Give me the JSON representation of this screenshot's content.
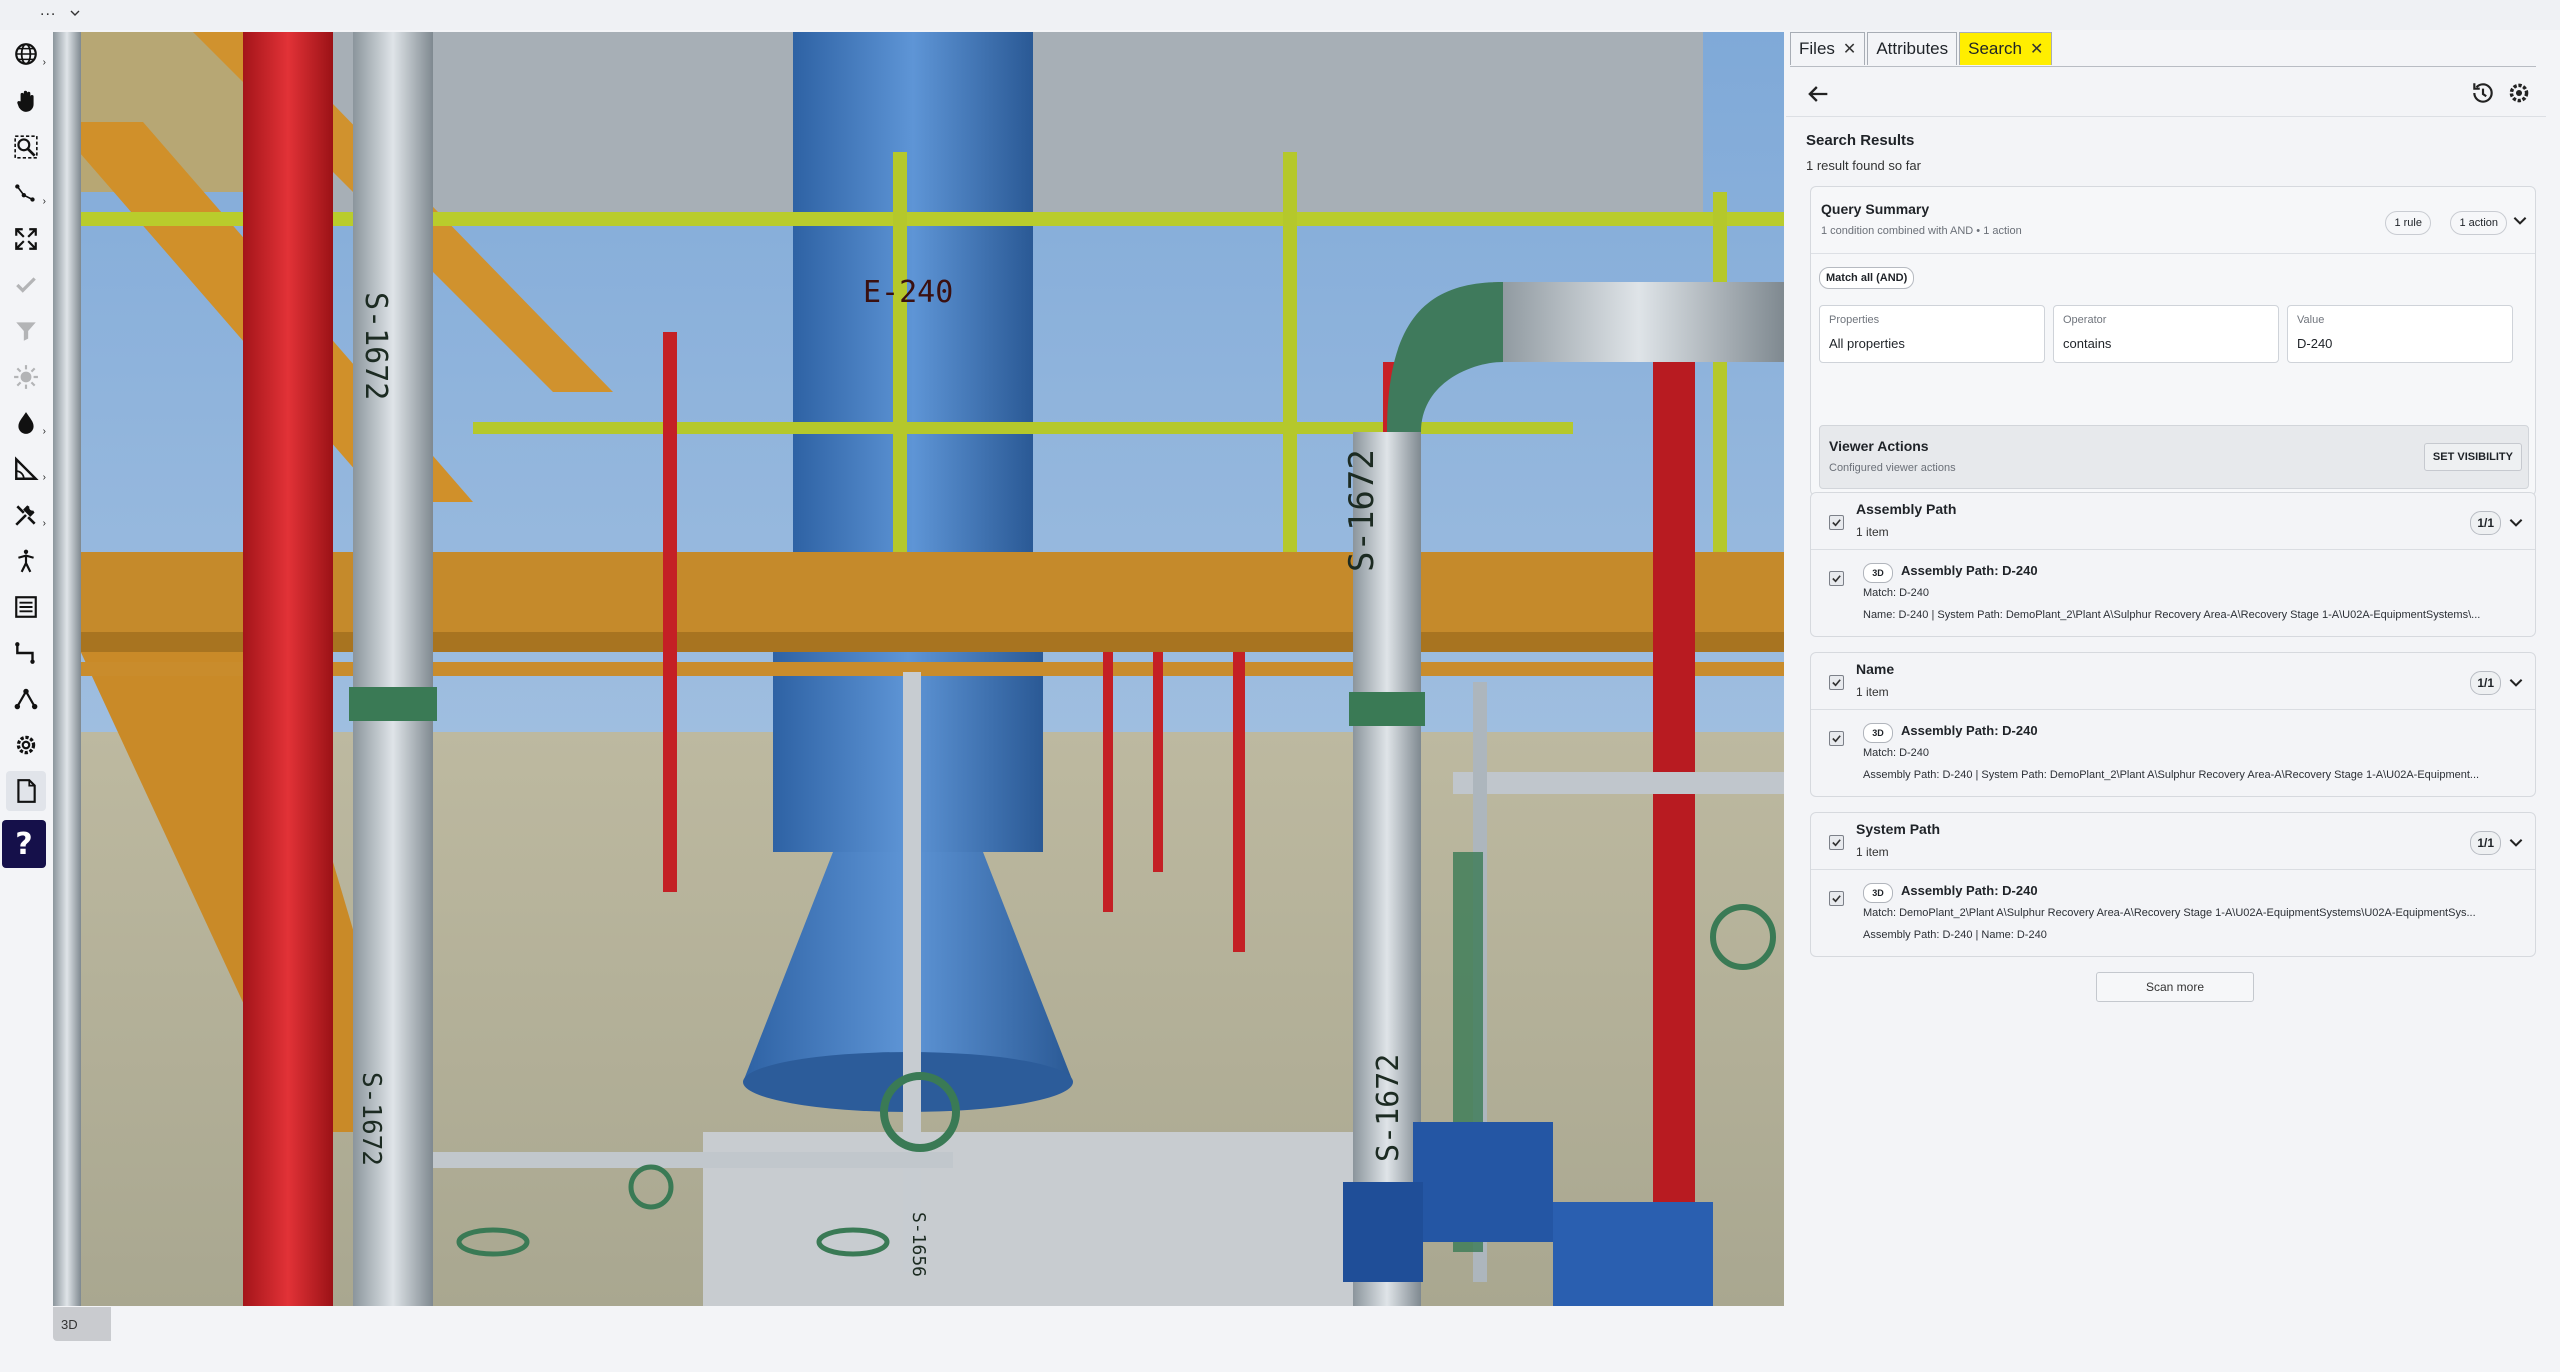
{
  "topbar": {
    "menu": "..."
  },
  "toolbar": {
    "items": [
      {
        "icon": "globe-icon"
      },
      {
        "icon": "pan-hand-icon"
      },
      {
        "icon": "zoom-icon"
      },
      {
        "icon": "path-nodes-icon"
      },
      {
        "icon": "fit-screen-icon"
      },
      {
        "icon": "check-icon"
      },
      {
        "icon": "filter-icon"
      },
      {
        "icon": "sun-icon"
      },
      {
        "icon": "droplet-icon"
      },
      {
        "icon": "measure-angle-icon"
      },
      {
        "icon": "tools-icon"
      },
      {
        "icon": "walk-icon"
      },
      {
        "icon": "list-icon"
      },
      {
        "icon": "routing-icon"
      },
      {
        "icon": "graph-icon"
      },
      {
        "icon": "settings-gear-icon"
      },
      {
        "icon": "document-icon"
      }
    ],
    "help_label": "?"
  },
  "viewport": {
    "badge": "3D",
    "labels": [
      "S-1672",
      "S-1672",
      "S-1672",
      "S-1672",
      "E-240",
      "S-1656"
    ]
  },
  "panel": {
    "tabs": [
      {
        "label": "Files",
        "closable": true
      },
      {
        "label": "Attributes",
        "closable": false
      },
      {
        "label": "Search",
        "closable": true,
        "active": true
      }
    ],
    "results_title": "Search Results",
    "results_subtitle": "1 result found so far",
    "query": {
      "title": "Query Summary",
      "subtitle": "1 condition combined with AND • 1 action",
      "rule_pill": "1 rule",
      "action_pill": "1 action",
      "match_all": "Match all (AND)",
      "fields": [
        {
          "label": "Properties",
          "value": "All properties"
        },
        {
          "label": "Operator",
          "value": "contains"
        },
        {
          "label": "Value",
          "value": "D-240"
        }
      ],
      "viewer_actions_title": "Viewer Actions",
      "viewer_actions_sub": "Configured viewer actions",
      "set_visibility": "SET VISIBILITY"
    },
    "groups": [
      {
        "title": "Assembly Path",
        "sub": "1 item",
        "count": "1/1",
        "item": {
          "badge": "3D",
          "title": "Assembly Path: D-240",
          "lines": [
            "Match: D-240",
            "Name: D-240 | System Path: DemoPlant_2\\Plant A\\Sulphur Recovery Area-A\\Recovery Stage 1-A\\U02A-EquipmentSystems\\..."
          ]
        }
      },
      {
        "title": "Name",
        "sub": "1 item",
        "count": "1/1",
        "item": {
          "badge": "3D",
          "title": "Assembly Path: D-240",
          "lines": [
            "Match: D-240",
            "Assembly Path: D-240 | System Path: DemoPlant_2\\Plant A\\Sulphur Recovery Area-A\\Recovery Stage 1-A\\U02A-Equipment..."
          ]
        }
      },
      {
        "title": "System Path",
        "sub": "1 item",
        "count": "1/1",
        "item": {
          "badge": "3D",
          "title": "Assembly Path: D-240",
          "lines": [
            "Match: DemoPlant_2\\Plant A\\Sulphur Recovery Area-A\\Recovery Stage 1-A\\U02A-EquipmentSystems\\U02A-EquipmentSys...",
            "Assembly Path: D-240 | Name: D-240"
          ]
        }
      }
    ],
    "scan_more": "Scan more"
  }
}
